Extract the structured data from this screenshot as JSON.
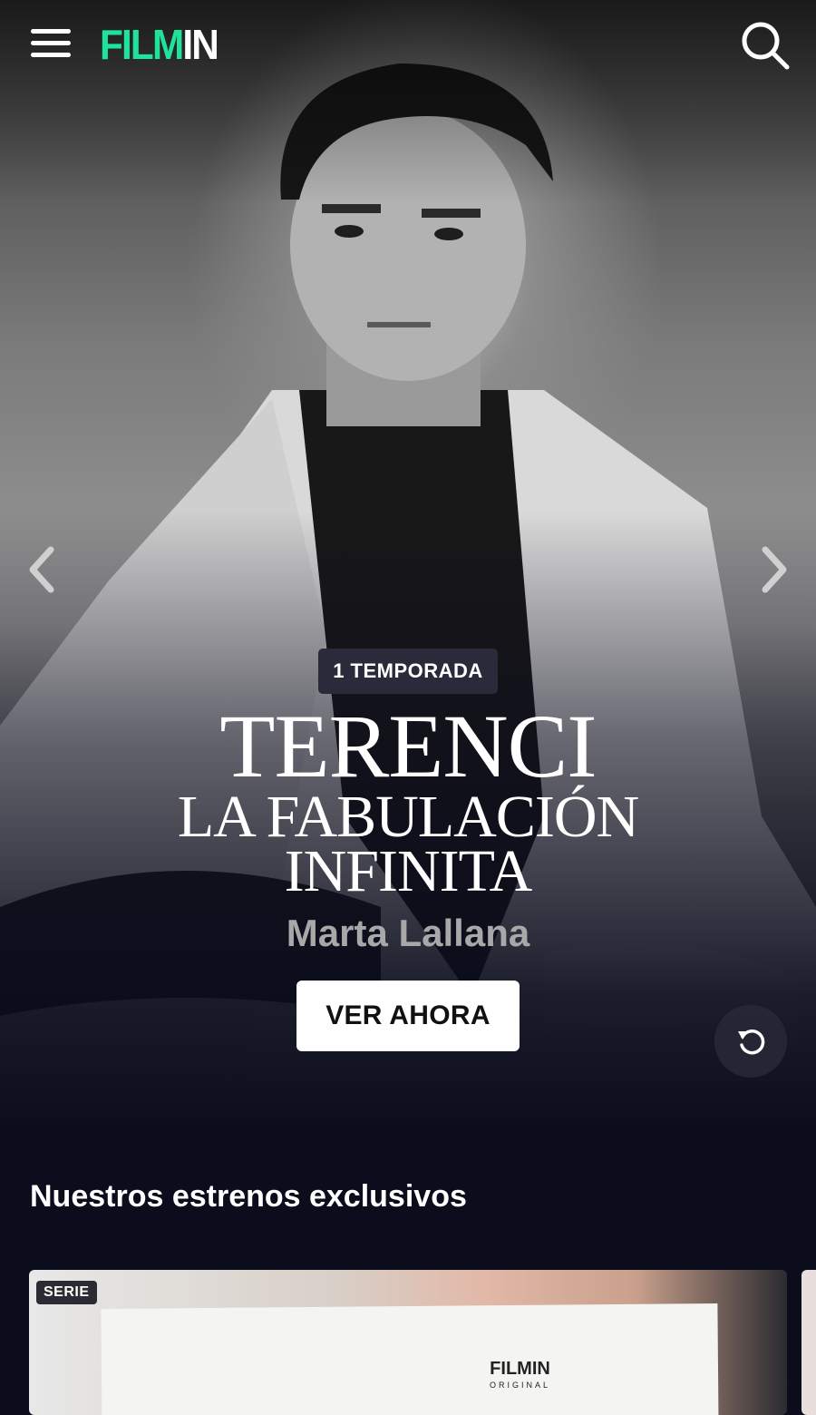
{
  "app": {
    "name": "Filmin",
    "logo_green": "FILM",
    "logo_white": "IN",
    "accent": "#1fe39b"
  },
  "header": {
    "menu_icon": "hamburger-icon",
    "search_icon": "search-icon"
  },
  "hero": {
    "badge": "1 TEMPORADA",
    "title_line1": "TERENCI",
    "title_line2": "LA FABULACIÓN",
    "title_line3": "INFINITA",
    "subtitle": "Marta Lallana",
    "cta_label": "VER AHORA",
    "prev_icon": "chevron-left-icon",
    "next_icon": "chevron-right-icon",
    "replay_icon": "replay-icon"
  },
  "sections": [
    {
      "title": "Nuestros estrenos exclusivos",
      "cards": [
        {
          "badge": "SERIE",
          "logo": "FILMIN",
          "logo_sub": "ORIGINAL"
        }
      ]
    }
  ]
}
